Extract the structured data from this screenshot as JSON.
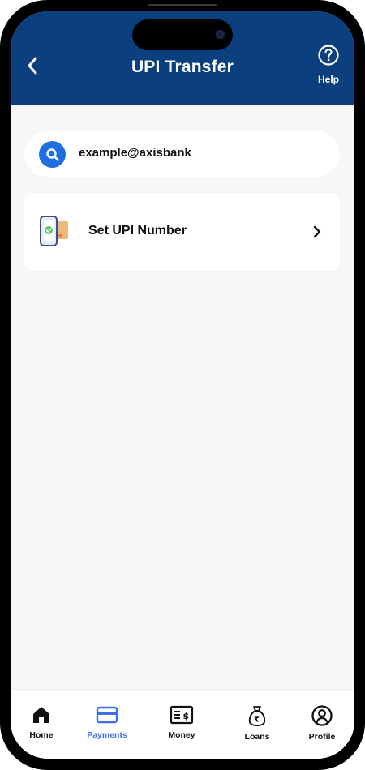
{
  "header": {
    "title": "UPI Transfer",
    "help_label": "Help"
  },
  "search": {
    "value": "example@axisbank"
  },
  "upi_card": {
    "label": "Set UPI Number"
  },
  "nav": [
    {
      "label": "Home",
      "icon": "home-icon",
      "active": false
    },
    {
      "label": "Payments",
      "icon": "card-icon",
      "active": true
    },
    {
      "label": "Money",
      "icon": "cheque-icon",
      "active": false
    },
    {
      "label": "Loans",
      "icon": "money-bag-icon",
      "active": false
    },
    {
      "label": "Profile",
      "icon": "profile-icon",
      "active": false
    }
  ],
  "colors": {
    "header_bg": "#0b3f7e",
    "accent": "#3f6ee8",
    "search_icon_bg": "#1f6fe0",
    "page_bg": "#f8f7f5"
  }
}
